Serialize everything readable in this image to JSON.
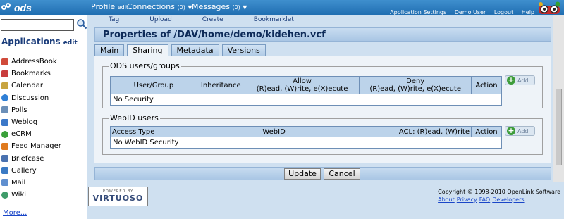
{
  "topbar": {
    "logo": "ods",
    "menus": [
      {
        "label": "Profile",
        "suffix": "edit",
        "caret": ""
      },
      {
        "label": "Connections",
        "suffix": "(0)",
        "caret": "▼"
      },
      {
        "label": "Messages",
        "suffix": "(0)",
        "caret": "▼"
      }
    ],
    "links": [
      "Application Settings",
      "Demo User",
      "Logout",
      "Help"
    ]
  },
  "sidebar": {
    "search": {
      "value": "",
      "placeholder": ""
    },
    "title": "Applications",
    "title_edit": "edit",
    "apps": [
      {
        "label": "AddressBook",
        "color": "#d04a3a"
      },
      {
        "label": "Bookmarks",
        "color": "#c93d3d"
      },
      {
        "label": "Calendar",
        "color": "#c8a440"
      },
      {
        "label": "Discussion",
        "color": "#2f7fd6"
      },
      {
        "label": "Polls",
        "color": "#6b8fb8"
      },
      {
        "label": "Weblog",
        "color": "#3b78c8"
      },
      {
        "label": "eCRM",
        "color": "#3aa03a"
      },
      {
        "label": "Feed Manager",
        "color": "#e07a1e"
      },
      {
        "label": "Briefcase",
        "color": "#4a72b0"
      },
      {
        "label": "Gallery",
        "color": "#3a7ac4"
      },
      {
        "label": "Mail",
        "color": "#5f8fcf"
      },
      {
        "label": "Wiki",
        "color": "#3f9c6a"
      }
    ],
    "more": "More..."
  },
  "toolbar": {
    "items": [
      "Tag",
      "Upload",
      "Create",
      "Bookmarklet"
    ]
  },
  "page": {
    "title": "Properties of /DAV/home/demo/kidehen.vcf"
  },
  "tabs": [
    {
      "label": "Main",
      "active": false
    },
    {
      "label": "Sharing",
      "active": true
    },
    {
      "label": "Metadata",
      "active": false
    },
    {
      "label": "Versions",
      "active": false
    }
  ],
  "ods_groups": {
    "legend": "ODS users/groups",
    "headers": {
      "user": "User/Group",
      "inheritance": "Inheritance",
      "allow_title": "Allow",
      "allow_sub": "(R)ead, (W)rite, e(X)ecute",
      "deny_title": "Deny",
      "deny_sub": "(R)ead, (W)rite, e(X)ecute",
      "action": "Action"
    },
    "empty": "No Security",
    "add": "Add"
  },
  "webid": {
    "legend": "WebID users",
    "headers": {
      "access_type": "Access Type",
      "webid": "WebID",
      "acl": "ACL: (R)ead, (W)rite",
      "action": "Action"
    },
    "empty": "No WebID Security",
    "add": "Add"
  },
  "buttons": {
    "update": "Update",
    "cancel": "Cancel"
  },
  "footer": {
    "powered_by": "POWERED BY",
    "virtuoso": "VIRTUOSO",
    "copyright": "Copyright © 1998-2010 OpenLink Software",
    "links": [
      "About",
      "Privacy",
      "FAQ",
      "Developers"
    ]
  },
  "colors": {
    "topbar": "#2a7ec0",
    "header": "#b3cde8",
    "panel": "#eef3f8",
    "add_plus": "#3d9c3a"
  }
}
